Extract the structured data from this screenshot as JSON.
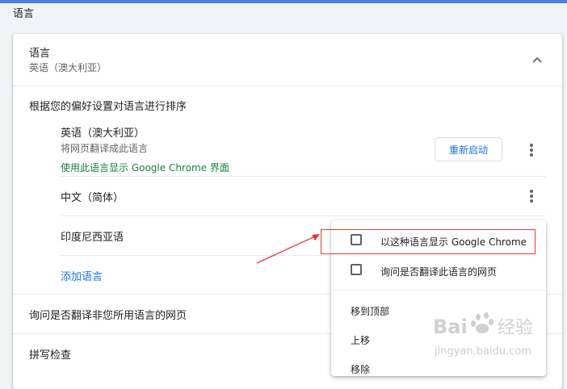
{
  "page": {
    "section_title": "语言",
    "accent_color": "#4a7fe0"
  },
  "language_card": {
    "title": "语言",
    "subtitle": "英语（澳大利亚）",
    "collapse_icon": "chevron-up-icon"
  },
  "language_order": {
    "description": "根据您的偏好设置对语言进行排序",
    "languages": [
      {
        "name": "英语（澳大利亚）",
        "translate_note": "将网页翻译成此语言",
        "ui_note": "使用此语言显示 Google Chrome 界面",
        "restart_label": "重新启动"
      },
      {
        "name": "中文（简体）"
      },
      {
        "name": "印度尼西亚语"
      }
    ],
    "add_language_label": "添加语言"
  },
  "settings_rows": {
    "offer_translate": "询问是否翻译非您所用语言的网页",
    "spell_check": "拼写检查"
  },
  "context_menu": {
    "items": [
      {
        "label": "以这种语言显示 Google Chrome",
        "checked": false
      },
      {
        "label": "询问是否翻译此语言的网页",
        "checked": false
      },
      {
        "label": "移到顶部"
      },
      {
        "label": "上移"
      },
      {
        "label": "移除"
      }
    ]
  },
  "annotation": {
    "highlight_color": "#e53935"
  },
  "watermark": {
    "text": "Baidu 经验",
    "url_text": "jingyan.baidu.com"
  }
}
